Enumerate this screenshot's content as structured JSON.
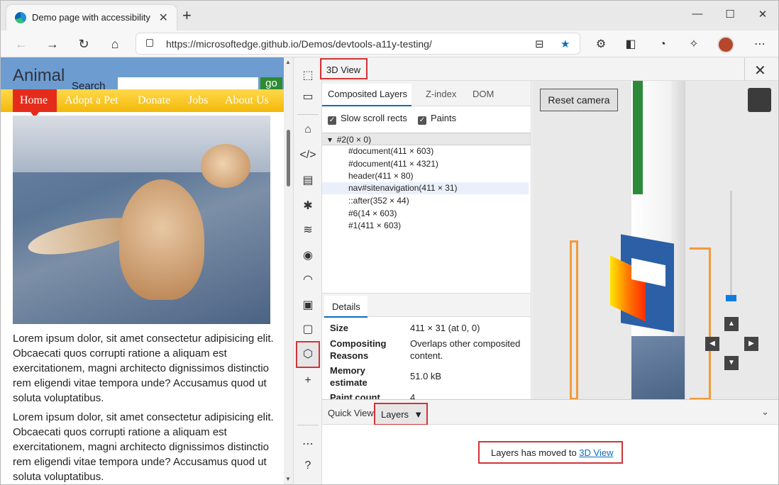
{
  "browser": {
    "tab_title": "Demo page with accessibility issues",
    "new_tab_glyph": "+",
    "url": "https://microsoftedge.github.io/Demos/devtools-a11y-testing/"
  },
  "site": {
    "logo_text": "Animal",
    "search_label": "Search",
    "go_label": "go",
    "nav": [
      "Home",
      "Adopt a Pet",
      "Donate",
      "Jobs",
      "About Us"
    ],
    "paragraph1": "Lorem ipsum dolor, sit amet consectetur adipisicing elit. Obcaecati quos corrupti ratione a aliquam est exercitationem, magni architecto dignissimos distinctio rem eligendi vitae tempora unde? Accusamus quod ut soluta voluptatibus.",
    "paragraph2": "Lorem ipsum dolor, sit amet consectetur adipisicing elit. Obcaecati quos corrupti ratione a aliquam est exercitationem, magni architecto dignissimos distinctio rem eligendi vitae tempora unde? Accusamus quod ut soluta voluptatibus."
  },
  "devtools": {
    "panel_title": "3D View",
    "layer_tabs": [
      "Composited Layers",
      "Z-index",
      "DOM"
    ],
    "checkboxes": [
      "Slow scroll rects",
      "Paints"
    ],
    "tree_root": "#2(0 × 0)",
    "tree": [
      "#document(411 × 603)",
      "#document(411 × 4321)",
      "header(411 × 80)",
      "nav#sitenavigation(411 × 31)",
      "::after(352 × 44)",
      "#6(14 × 603)",
      "#1(411 × 603)"
    ],
    "details_tab": "Details",
    "details": [
      {
        "key": "Size",
        "value": "411 × 31 (at 0, 0)"
      },
      {
        "key": "Compositing Reasons",
        "value": "Overlaps other composited content."
      },
      {
        "key": "Memory estimate",
        "value": "51.0 kB"
      },
      {
        "key": "Paint count",
        "value": "4"
      }
    ],
    "reset_camera": "Reset camera",
    "drawer": {
      "quick_view": "Quick View",
      "layers_tab": "Layers",
      "message_prefix": "Layers has moved to ",
      "message_link": "3D View"
    }
  },
  "colors": {
    "highlight": "#d13438",
    "accent": "#0f6cbd",
    "site_header": "#6c9cd0",
    "nav_yellow": "#f2b90a",
    "nav_active": "#e52c1b"
  }
}
